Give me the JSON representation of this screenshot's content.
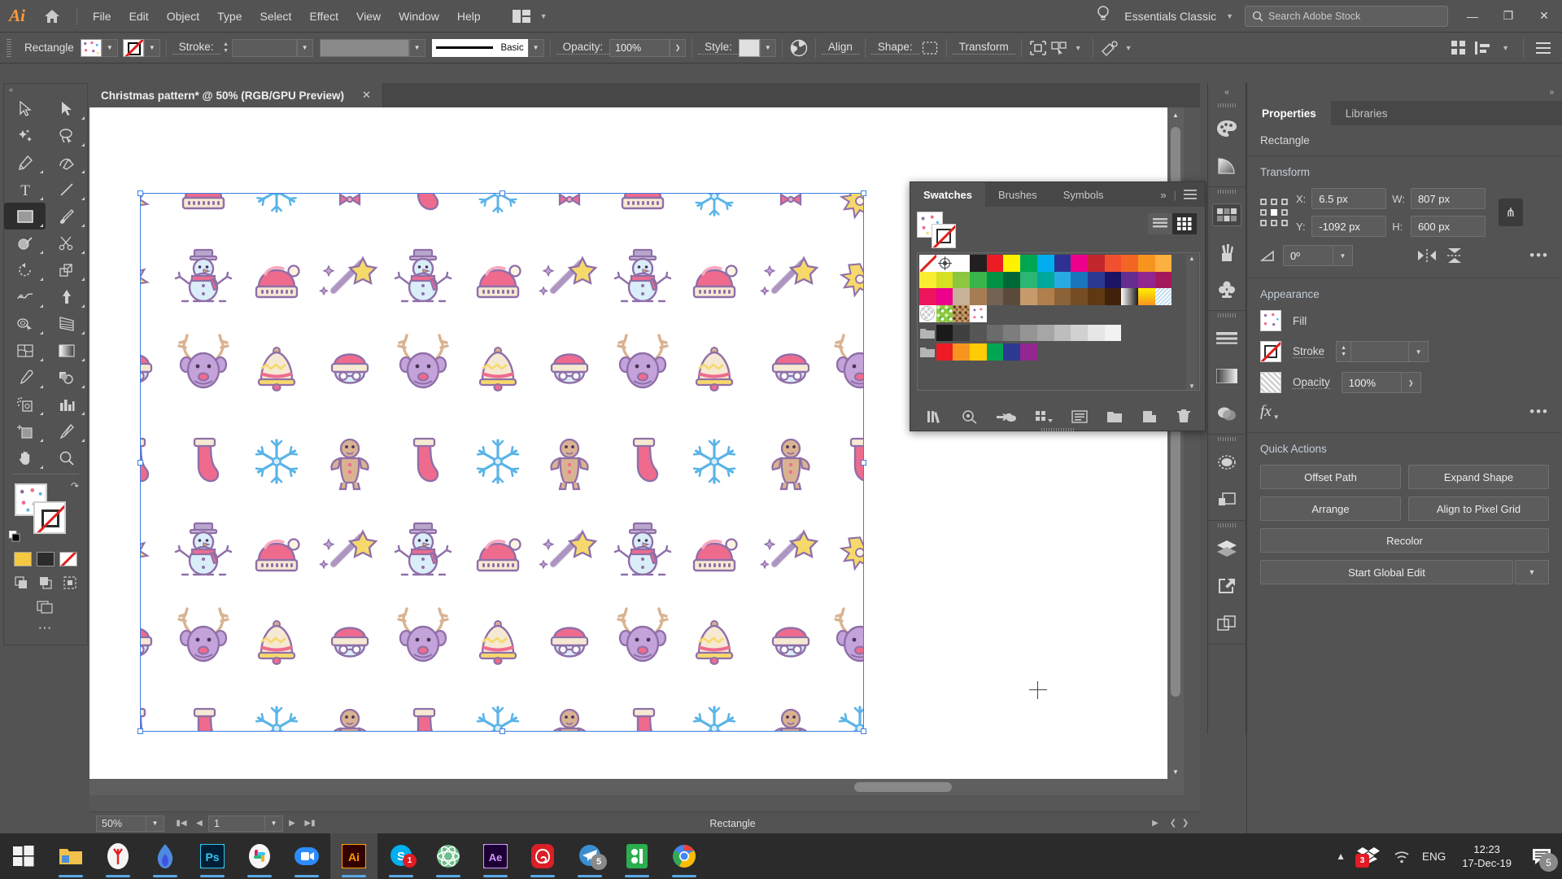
{
  "app": {
    "name": "Adobe Illustrator",
    "logo_text": "Ai",
    "workspace": "Essentials Classic",
    "stock_placeholder": "Search Adobe Stock"
  },
  "menubar": {
    "items": [
      "File",
      "Edit",
      "Object",
      "Type",
      "Select",
      "Effect",
      "View",
      "Window",
      "Help"
    ],
    "window_controls": [
      "—",
      "❐",
      "✕"
    ]
  },
  "controlbar": {
    "object_label": "Rectangle",
    "stroke_label": "Stroke:",
    "stroke_weight": "",
    "stroke_profile": "Basic",
    "opacity_label": "Opacity:",
    "opacity_value": "100%",
    "style_label": "Style:",
    "align_label": "Align",
    "shape_label": "Shape:",
    "transform_label": "Transform"
  },
  "toolbar": {
    "tools": [
      {
        "name": "selection-tool"
      },
      {
        "name": "direct-selection-tool"
      },
      {
        "name": "magic-wand-tool"
      },
      {
        "name": "lasso-tool"
      },
      {
        "name": "pen-tool"
      },
      {
        "name": "curvature-tool"
      },
      {
        "name": "type-tool"
      },
      {
        "name": "line-segment-tool"
      },
      {
        "name": "rectangle-tool"
      },
      {
        "name": "paintbrush-tool"
      },
      {
        "name": "shaper-tool"
      },
      {
        "name": "scissors-tool"
      },
      {
        "name": "rotate-tool"
      },
      {
        "name": "scale-tool"
      },
      {
        "name": "width-tool"
      },
      {
        "name": "free-transform-tool"
      },
      {
        "name": "shape-builder-tool"
      },
      {
        "name": "perspective-grid-tool"
      },
      {
        "name": "mesh-tool"
      },
      {
        "name": "gradient-tool"
      },
      {
        "name": "eyedropper-tool"
      },
      {
        "name": "blend-tool"
      },
      {
        "name": "symbol-sprayer-tool"
      },
      {
        "name": "column-graph-tool"
      },
      {
        "name": "artboard-tool"
      },
      {
        "name": "slice-tool"
      },
      {
        "name": "hand-tool"
      },
      {
        "name": "zoom-tool"
      }
    ]
  },
  "document": {
    "tab_title": "Christmas pattern* @ 50% (RGB/GPU Preview)",
    "close_label": "✕"
  },
  "statusbar": {
    "zoom": "50%",
    "page": "1",
    "tool_name": "Rectangle"
  },
  "swatches_panel": {
    "tabs": [
      "Swatches",
      "Brushes",
      "Symbols"
    ],
    "active_tab": "Swatches",
    "overflow_label": "»",
    "rows": [
      [
        "none",
        "registration",
        "#ffffff",
        "#231f20",
        "#ed1c24",
        "#fff200",
        "#00a651",
        "#00aeef",
        "#2e3192",
        "#ec008c",
        "#c1272d",
        "#f1502f",
        "#f26522",
        "#f7941e",
        "#fbb040"
      ],
      [
        "#f9ed32",
        "#d7df23",
        "#8dc63f",
        "#39b54a",
        "#009245",
        "#006837",
        "#2bb673",
        "#00a79d",
        "#27aae1",
        "#1b75bc",
        "#2b3990",
        "#1b1464",
        "#662d91",
        "#92278f",
        "#a3195b"
      ],
      [
        "#ed145b",
        "#ec008c",
        "#c7b299",
        "#a67c52",
        "#754c24",
        "#603913",
        "#c69c6d",
        "#b07f4b",
        "#8c6239",
        "#754c24",
        "#603913",
        "#42210b",
        "gradient-white-black",
        "gradient-yellow-orange",
        "pattern-blue-dots"
      ],
      [
        "pattern-checker-circle",
        "pattern-green-leaf",
        "pattern-brown-texture",
        "pattern-christmas"
      ],
      [
        "folder",
        "#1a1a1a",
        "#404040",
        "#535353",
        "#6b6b6b",
        "#7d7d7d",
        "#949494",
        "#a6a6a6",
        "#bdbdbd",
        "#d1d1d1",
        "#e6e6e6",
        "#f2f2f2"
      ],
      [
        "folder",
        "#ed1c24",
        "#f7941e",
        "#ffcb05",
        "#00a651",
        "#2b3990",
        "#92278f"
      ]
    ],
    "footer_icons": [
      "swatch-libraries-icon",
      "color-themes-icon",
      "cc-libraries-icon",
      "show-swatch-kinds-icon",
      "swatch-options-icon",
      "new-color-group-icon",
      "new-swatch-icon",
      "delete-swatch-icon"
    ]
  },
  "icondock": {
    "collapse_label": "«",
    "groups": [
      [
        "color-palette-icon",
        "color-guide-icon"
      ],
      [
        "swatches-icon",
        "brushes-icon",
        "symbols-icon"
      ],
      [
        "stroke-icon",
        "gradient-icon",
        "transparency-icon"
      ],
      [
        "appearance-icon",
        "graphic-styles-icon"
      ],
      [
        "layers-icon",
        "artboards-icon",
        "asset-export-icon"
      ]
    ]
  },
  "properties": {
    "expand_label": "»",
    "tabs": [
      "Properties",
      "Libraries"
    ],
    "active_tab": "Properties",
    "object_name": "Rectangle",
    "transform": {
      "title": "Transform",
      "x_label": "X:",
      "x_value": "6.5 px",
      "y_label": "Y:",
      "y_value": "-1092 px",
      "w_label": "W:",
      "w_value": "807 px",
      "h_label": "H:",
      "h_value": "600 px",
      "angle_value": "0º",
      "more_label": "•••"
    },
    "appearance": {
      "title": "Appearance",
      "fill_label": "Fill",
      "stroke_label": "Stroke",
      "stroke_weight": "",
      "opacity_label": "Opacity",
      "opacity_value": "100%",
      "fx_label": "fx",
      "more_label": "•••"
    },
    "quick_actions": {
      "title": "Quick Actions",
      "buttons": [
        "Offset Path",
        "Expand Shape",
        "Arrange",
        "Align to Pixel Grid",
        "Recolor",
        "Start Global Edit"
      ]
    }
  },
  "taskbar": {
    "start_label": "start-button",
    "apps": [
      {
        "name": "file-explorer",
        "label": "■"
      },
      {
        "name": "yandex-browser",
        "label": "Y"
      },
      {
        "name": "flamingo-app",
        "label": ""
      },
      {
        "name": "photoshop",
        "label": "Ps"
      },
      {
        "name": "slack",
        "label": ""
      },
      {
        "name": "zoom-meetings",
        "label": ""
      },
      {
        "name": "illustrator",
        "label": "Ai"
      },
      {
        "name": "skype",
        "label": "S"
      },
      {
        "name": "atom-editor",
        "label": ""
      },
      {
        "name": "after-effects",
        "label": "Ae"
      },
      {
        "name": "creative-cloud",
        "label": ""
      },
      {
        "name": "telegram",
        "label": ""
      },
      {
        "name": "bitbucket",
        "label": ""
      },
      {
        "name": "chrome",
        "label": ""
      }
    ],
    "tray": {
      "language": "ENG",
      "time": "12:23",
      "date": "17-Dec-19",
      "dropbox_badge": "3",
      "skype_badge": "1",
      "telegram_badge": "5",
      "notification_badge": "5"
    }
  },
  "colors": {
    "panel_bg": "#535353",
    "panel_dark": "#474747",
    "accent_blue": "#3f7fe0",
    "ai_orange": "#ff9a3c",
    "text": "#d4d4d4"
  },
  "pattern": {
    "name": "christmas-pattern",
    "motifs": [
      "snowman",
      "santa-hat",
      "magic-wand",
      "deer",
      "bell",
      "gingerbread-man",
      "stocking",
      "snowflake",
      "star",
      "santa-face"
    ],
    "colors": {
      "pink": "#ef6b8e",
      "pink_dark": "#d9537a",
      "purple": "#8f6fa8",
      "blue_light": "#c9e6f5",
      "blue": "#5ab4e8",
      "cream": "#f3e0c7",
      "tan": "#d9b391",
      "yellow": "#f6d96b"
    }
  }
}
